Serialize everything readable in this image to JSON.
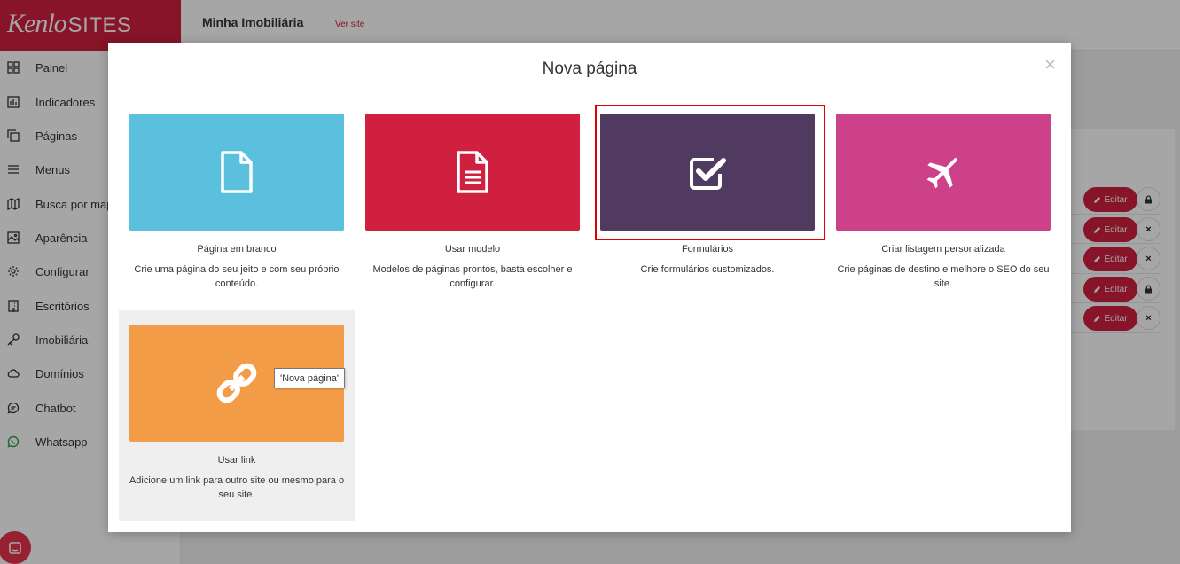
{
  "brand": {
    "name_part1": "Kenlo",
    "name_part2": "SITES",
    "color": "#d01f3f"
  },
  "topbar": {
    "title": "Minha Imobiliária",
    "link": "Ver site"
  },
  "sidebar": {
    "items": [
      {
        "label": "Painel",
        "icon": "grid-icon"
      },
      {
        "label": "Indicadores",
        "icon": "bar-chart-icon"
      },
      {
        "label": "Páginas",
        "icon": "pages-icon"
      },
      {
        "label": "Menus",
        "icon": "menu-icon"
      },
      {
        "label": "Busca por mapa",
        "icon": "map-icon"
      },
      {
        "label": "Aparência",
        "icon": "image-icon"
      },
      {
        "label": "Configurar",
        "icon": "gear-icon"
      },
      {
        "label": "Escritórios",
        "icon": "building-icon"
      },
      {
        "label": "Imobiliária",
        "icon": "key-icon"
      },
      {
        "label": "Domínios",
        "icon": "cloud-icon"
      },
      {
        "label": "Chatbot",
        "icon": "chat-icon"
      },
      {
        "label": "Whatsapp",
        "icon": "whatsapp-icon"
      }
    ]
  },
  "page_rows": {
    "edit_label": "Editar",
    "rows": [
      {
        "action": "lock"
      },
      {
        "action": "×"
      },
      {
        "action": "×"
      },
      {
        "action": "lock"
      },
      {
        "action": "×"
      }
    ]
  },
  "modal": {
    "title": "Nova página",
    "close": "×",
    "cards": [
      {
        "name": "Página em branco",
        "description": "Crie uma página do seu jeito e com seu próprio conteúdo.",
        "color": "#5bc0de",
        "icon": "blank-page-icon"
      },
      {
        "name": "Usar modelo",
        "description": "Modelos de páginas prontos, basta escolher e configurar.",
        "color": "#d0203f",
        "icon": "document-icon"
      },
      {
        "name": "Formulários",
        "description": "Crie formulários customizados.",
        "color": "#513a5f",
        "icon": "checkbox-icon",
        "selected": true
      },
      {
        "name": "Criar listagem personalizada",
        "description": "Crie páginas de destino e melhore o SEO do seu site.",
        "color": "#cc4189",
        "icon": "airplane-icon"
      },
      {
        "name": "Usar link",
        "description": "Adicione um link para outro site ou mesmo para o seu site.",
        "color": "#f39c48",
        "icon": "link-icon",
        "hovered": true
      }
    ],
    "tooltip": "'Nova página'"
  }
}
